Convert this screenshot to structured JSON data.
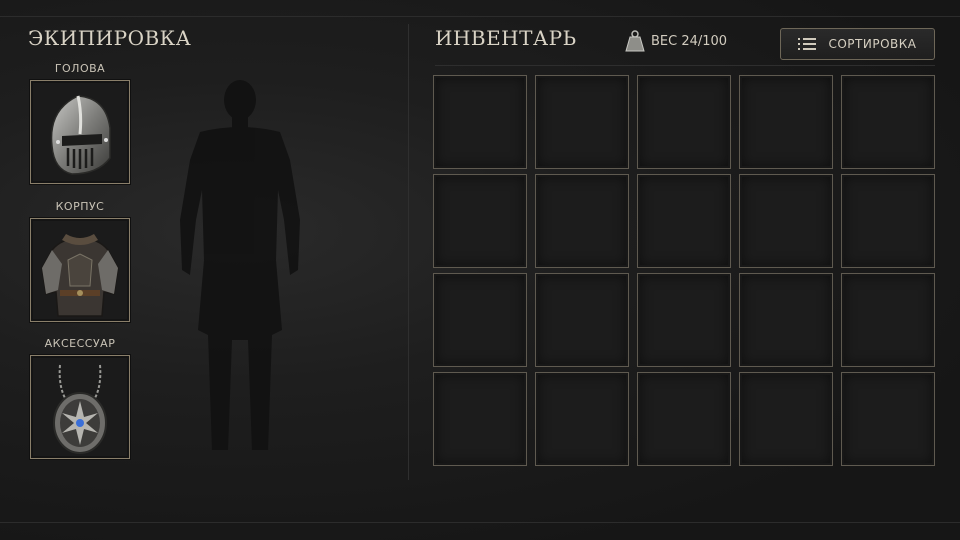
{
  "equipment": {
    "title": "ЭКИПИРОВКА",
    "slots": [
      {
        "label": "ГОЛОВА",
        "item_icon": "helmet-icon"
      },
      {
        "label": "КОРПУС",
        "item_icon": "armor-icon"
      },
      {
        "label": "АКСЕССУАР",
        "item_icon": "amulet-icon"
      }
    ]
  },
  "inventory": {
    "title": "ИНВЕНТАРЬ",
    "weight_label": "ВЕС 24/100",
    "weight_icon": "weight-icon",
    "sort_label": "СОРТИРОВКА",
    "sort_icon": "list-icon",
    "rows": 4,
    "columns": 5,
    "occupied_cells": 0
  },
  "colors": {
    "background": "#1a1a1a",
    "slot_border": "#8a7f6a",
    "cell_border": "#5f5a50",
    "text": "#d8d2c4"
  }
}
